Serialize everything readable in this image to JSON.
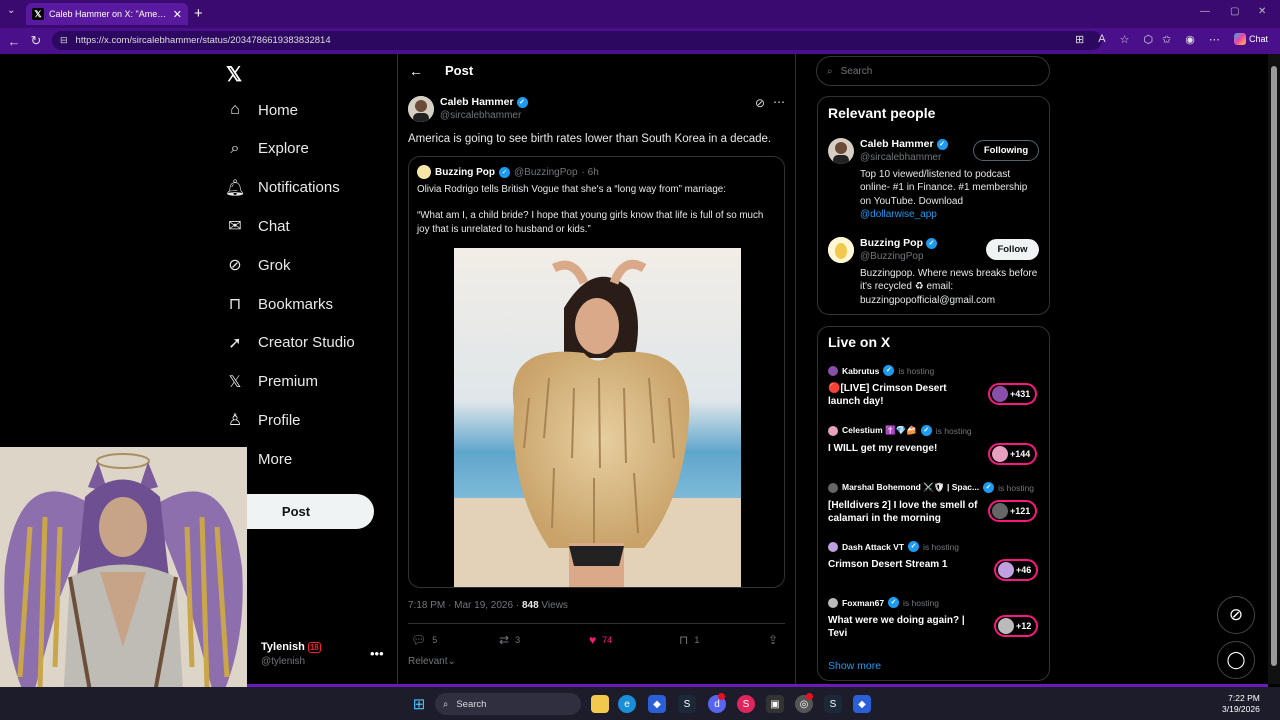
{
  "browser": {
    "tab_title": "Caleb Hammer on X: \"America is g",
    "url": "https://x.com/sircalebhammer/status/2034786619383832814",
    "chat_label": "Chat"
  },
  "nav": {
    "items": [
      {
        "label": "Home",
        "icon": "home-icon"
      },
      {
        "label": "Explore",
        "icon": "search-icon"
      },
      {
        "label": "Notifications",
        "icon": "bell-icon"
      },
      {
        "label": "Chat",
        "icon": "mail-icon"
      },
      {
        "label": "Grok",
        "icon": "grok-icon"
      },
      {
        "label": "Bookmarks",
        "icon": "bookmark-icon"
      },
      {
        "label": "Creator Studio",
        "icon": "rocket-icon"
      },
      {
        "label": "Premium",
        "icon": "x-icon"
      },
      {
        "label": "Profile",
        "icon": "person-icon"
      },
      {
        "label": "More",
        "icon": "more-circle-icon"
      }
    ],
    "post_label": "Post",
    "account": {
      "name": "Tylenish",
      "badge": "18",
      "handle": "@tylenish"
    }
  },
  "post": {
    "header": "Post",
    "author": "Caleb Hammer",
    "handle": "@sircalebhammer",
    "text": "America is going to see birth rates lower than South Korea in a decade.",
    "quote": {
      "author": "Buzzing Pop",
      "handle": "@BuzzingPop",
      "time": "· 6h",
      "line1": "Olivia Rodrigo tells British Vogue that she's a “long way from” marriage:",
      "line2": "“What am I, a child bride? I hope that young girls know that life is full of so much joy that is unrelated to husband or kids.”"
    },
    "timestamp": "7:18 PM · Mar 19, 2026 · ",
    "views": "848",
    "views_label": " Views",
    "actions": {
      "replies": "5",
      "reposts": "3",
      "likes": "74",
      "bookmarks": "1"
    },
    "sort": "Relevant"
  },
  "sidebar": {
    "search_placeholder": "Search",
    "relevant_title": "Relevant people",
    "people": [
      {
        "name": "Caleb Hammer",
        "handle": "@sircalebhammer",
        "bio": "Top 10 viewed/listened to podcast online- #1 in Finance. #1 membership on YouTube. Download ",
        "link": "@dollarwise_app",
        "button": "Following"
      },
      {
        "name": "Buzzing Pop",
        "handle": "@BuzzingPop",
        "bio": "Buzzingpop. Where news breaks before it's recycled ♻ email: buzzingpopofficial@gmail.com",
        "link": "",
        "button": "Follow"
      }
    ],
    "live_title": "Live on X",
    "hosting_label": "is hosting",
    "live": [
      {
        "host": "Kabrutus",
        "title": "🔴[LIVE] Crimson Desert launch day!",
        "count": "+431",
        "color": "#8a4fa8"
      },
      {
        "host": "Celestium ✝️💎🍰",
        "title": "I WILL get my revenge!",
        "count": "+144",
        "color": "#e7a0c0"
      },
      {
        "host": "Marshal Bohemond ⚔️🛡 | Spac...",
        "title": "[Helldivers 2] I love the smell of calamari in the morning",
        "count": "+121",
        "color": "#666"
      },
      {
        "host": "Dash Attack VT",
        "title": "Crimson Desert Stream 1",
        "count": "+46",
        "color": "#c0a0e0"
      },
      {
        "host": "Foxman67",
        "title": "What were we doing again? | Tevi",
        "count": "+12",
        "color": "#bbb"
      }
    ],
    "show_more": "Show more"
  },
  "taskbar": {
    "search": "Search",
    "time": "7:22 PM",
    "date": "3/19/2026"
  }
}
